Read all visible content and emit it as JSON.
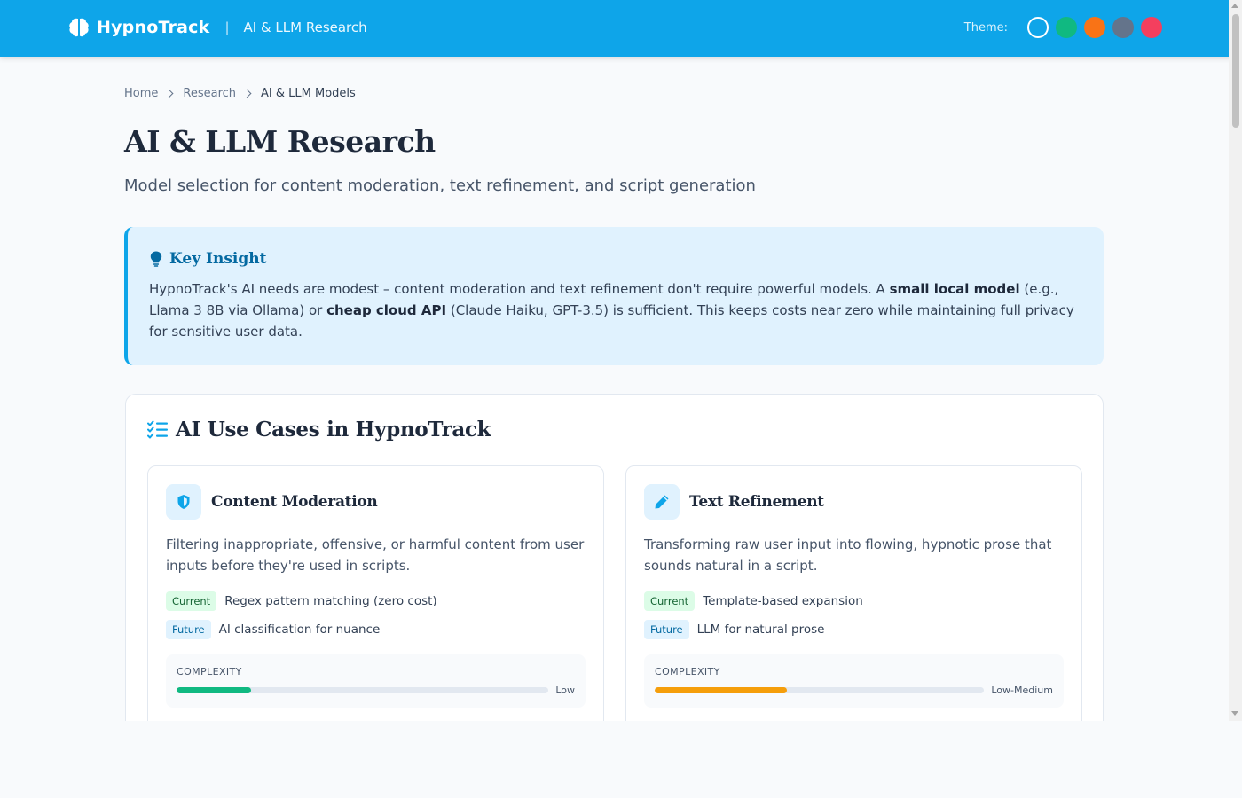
{
  "header": {
    "brand_name": "HypnoTrack",
    "separator": "|",
    "section": "AI & LLM Research",
    "theme_label": "Theme:",
    "theme_swatches": [
      {
        "name": "sky",
        "color": "#0ea5e9",
        "active": true
      },
      {
        "name": "green",
        "color": "#10b981",
        "active": false
      },
      {
        "name": "orange",
        "color": "#f97316",
        "active": false
      },
      {
        "name": "slate",
        "color": "#64748b",
        "active": false
      },
      {
        "name": "rose",
        "color": "#f43f5e",
        "active": false
      }
    ]
  },
  "breadcrumb": {
    "items": [
      "Home",
      "Research"
    ],
    "current": "AI & LLM Models"
  },
  "page": {
    "title": "AI & LLM Research",
    "subtitle": "Model selection for content moderation, text refinement, and script generation"
  },
  "insight": {
    "icon": "lightbulb-icon",
    "title": "Key Insight",
    "text_1": "HypnoTrack's AI needs are modest – content moderation and text refinement don't require powerful models. A ",
    "bold_1": "small local model",
    "text_2": " (e.g., Llama 3 8B via Ollama) or ",
    "bold_2": "cheap cloud API",
    "text_3": " (Claude Haiku, GPT-3.5) is sufficient. This keeps costs near zero while maintaining full privacy for sensitive user data."
  },
  "use_cases": {
    "icon": "checklist-icon",
    "title": "AI Use Cases in HypnoTrack",
    "cards": [
      {
        "icon": "shield-icon",
        "title": "Content Moderation",
        "description": "Filtering inappropriate, offensive, or harmful content from user inputs before they're used in scripts.",
        "current_tag": "Current",
        "current_text": "Regex pattern matching (zero cost)",
        "future_tag": "Future",
        "future_text": "AI classification for nuance",
        "complexity_label": "COMPLEXITY",
        "complexity_level": "Low",
        "complexity_value": 0.2,
        "complexity_color": "#10b981"
      },
      {
        "icon": "pencil-icon",
        "title": "Text Refinement",
        "description": "Transforming raw user input into flowing, hypnotic prose that sounds natural in a script.",
        "current_tag": "Current",
        "current_text": "Template-based expansion",
        "future_tag": "Future",
        "future_text": "LLM for natural prose",
        "complexity_label": "COMPLEXITY",
        "complexity_level": "Low-Medium",
        "complexity_value": 0.4,
        "complexity_color": "#f59e0b"
      }
    ]
  }
}
